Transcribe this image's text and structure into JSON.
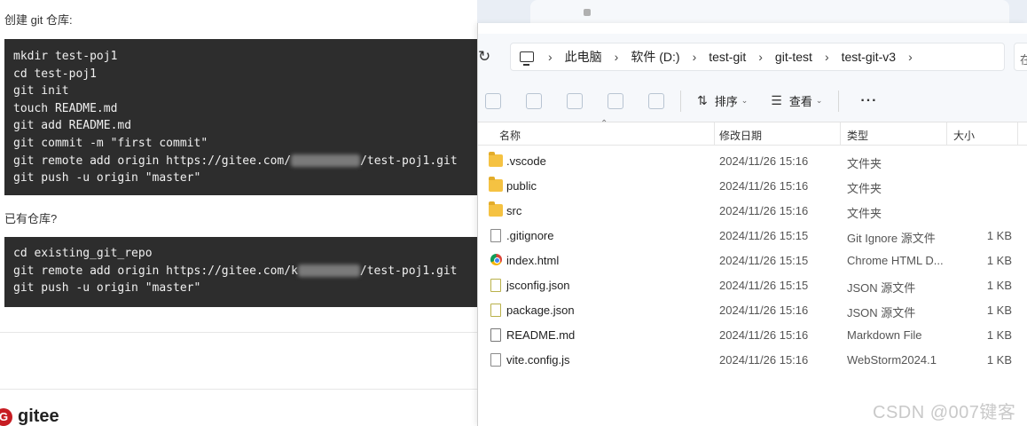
{
  "web": {
    "label_create": "创建 git 仓库:",
    "code_create": [
      "mkdir test-poj1",
      "cd test-poj1",
      "git init",
      "touch README.md",
      "git add README.md",
      "git commit -m \"first commit\"",
      "git remote add origin https://gitee.com/",
      "git push -u origin \"master\""
    ],
    "code_create_remote_suffix": "/test-poj1.git",
    "label_existing": "已有仓库?",
    "code_existing": [
      "cd existing_git_repo",
      "git remote add origin https://gitee.com/",
      "git push -u origin \"master\""
    ],
    "code_existing_remote_prefix_char": "k",
    "code_existing_remote_suffix": "/test-poj1.git",
    "gitee_name": "gitee",
    "gitee_logo_letter": "G"
  },
  "explorer": {
    "breadcrumb": [
      "此电脑",
      "软件 (D:)",
      "test-git",
      "git-test",
      "test-git-v3"
    ],
    "addr_right_text": "在",
    "toolbar": {
      "sort_label": "排序",
      "view_label": "查看",
      "more_label": "···"
    },
    "columns": {
      "name": "名称",
      "modified": "修改日期",
      "type": "类型",
      "size": "大小"
    },
    "files": [
      {
        "icon": "folder-icon",
        "name": ".vscode",
        "modified": "2024/11/26 15:16",
        "type": "文件夹",
        "size": ""
      },
      {
        "icon": "folder-icon",
        "name": "public",
        "modified": "2024/11/26 15:16",
        "type": "文件夹",
        "size": ""
      },
      {
        "icon": "folder-icon",
        "name": "src",
        "modified": "2024/11/26 15:16",
        "type": "文件夹",
        "size": ""
      },
      {
        "icon": "config-file-icon",
        "name": ".gitignore",
        "modified": "2024/11/26 15:15",
        "type": "Git Ignore 源文件",
        "size": "1 KB"
      },
      {
        "icon": "chrome-html-icon",
        "name": "index.html",
        "modified": "2024/11/26 15:15",
        "type": "Chrome HTML D...",
        "size": "1 KB"
      },
      {
        "icon": "json-file-icon",
        "name": "jsconfig.json",
        "modified": "2024/11/26 15:15",
        "type": "JSON 源文件",
        "size": "1 KB"
      },
      {
        "icon": "json-file-icon",
        "name": "package.json",
        "modified": "2024/11/26 15:16",
        "type": "JSON 源文件",
        "size": "1 KB"
      },
      {
        "icon": "markdown-file-icon",
        "name": "README.md",
        "modified": "2024/11/26 15:16",
        "type": "Markdown File",
        "size": "1 KB"
      },
      {
        "icon": "file-icon",
        "name": "vite.config.js",
        "modified": "2024/11/26 15:16",
        "type": "WebStorm2024.1",
        "size": "1 KB"
      }
    ]
  },
  "watermark": "CSDN @007键客"
}
